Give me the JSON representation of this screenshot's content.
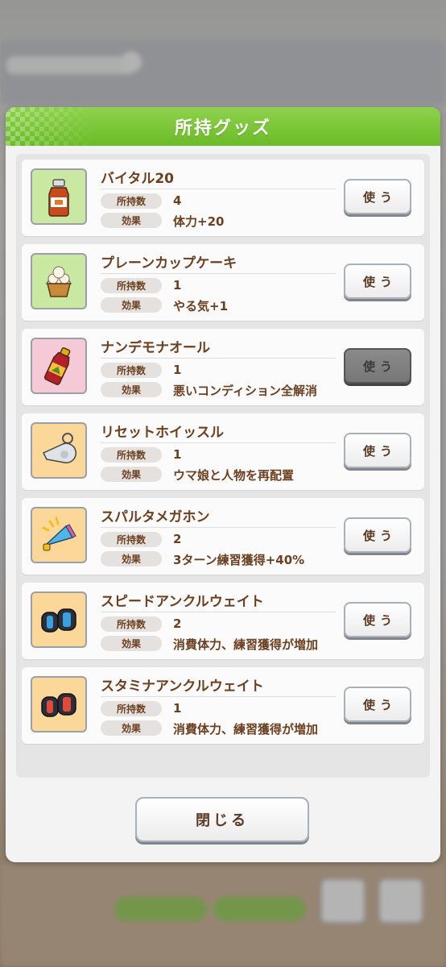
{
  "dialog": {
    "title": "所持グッズ",
    "close_label": "閉じる"
  },
  "labels": {
    "count": "所持数",
    "effect": "効果",
    "use": "使う"
  },
  "items": [
    {
      "name": "バイタル20",
      "count": "4",
      "effect": "体力+20",
      "icon": "energy-drink-icon",
      "icon_bg": "#c9e9a3",
      "use_enabled": true
    },
    {
      "name": "プレーンカップケーキ",
      "count": "1",
      "effect": "やる気+1",
      "icon": "cupcake-icon",
      "icon_bg": "#c9e9a3",
      "use_enabled": true
    },
    {
      "name": "ナンデモナオール",
      "count": "1",
      "effect": "悪いコンディション全解消",
      "icon": "medicine-bottle-icon",
      "icon_bg": "#f5c9d6",
      "use_enabled": false
    },
    {
      "name": "リセットホイッスル",
      "count": "1",
      "effect": "ウマ娘と人物を再配置",
      "icon": "whistle-icon",
      "icon_bg": "#fbd79a",
      "use_enabled": true
    },
    {
      "name": "スパルタメガホン",
      "count": "2",
      "effect": "3ターン練習獲得+40%",
      "icon": "megaphone-icon",
      "icon_bg": "#fbd79a",
      "use_enabled": true
    },
    {
      "name": "スピードアンクルウェイト",
      "count": "2",
      "effect": "消費体力、練習獲得が増加",
      "icon": "ankle-weight-blue-icon",
      "icon_bg": "#fbd79a",
      "use_enabled": true
    },
    {
      "name": "スタミナアンクルウェイト",
      "count": "1",
      "effect": "消費体力、練習獲得が増加",
      "icon": "ankle-weight-red-icon",
      "icon_bg": "#fbd79a",
      "use_enabled": true
    }
  ],
  "colors": {
    "header_green": "#7cc63a",
    "text_brown": "#6b3f1f",
    "button_disabled": "#7f7f7f"
  }
}
